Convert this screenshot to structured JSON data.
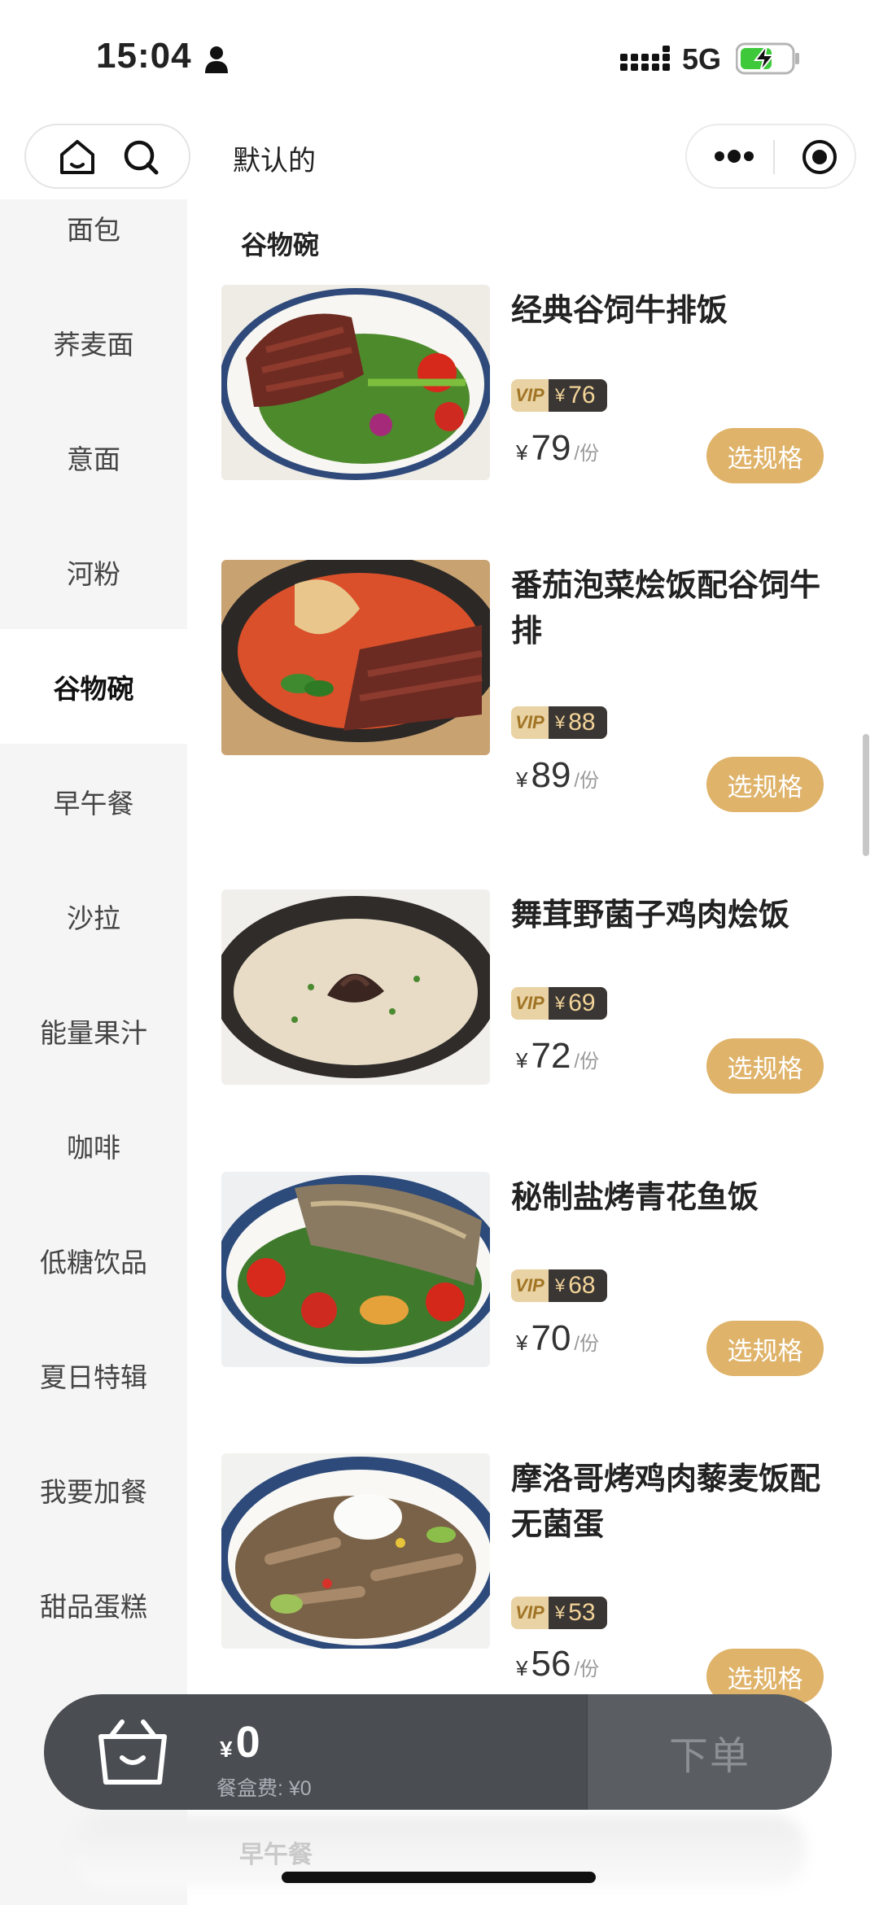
{
  "status_bar": {
    "time": "15:04",
    "network": "5G"
  },
  "nav": {
    "title": "默认的"
  },
  "sidebar": {
    "items": [
      {
        "label": "面包"
      },
      {
        "label": "荞麦面"
      },
      {
        "label": "意面"
      },
      {
        "label": "河粉"
      },
      {
        "label": "谷物碗",
        "active": true
      },
      {
        "label": "早午餐"
      },
      {
        "label": "沙拉"
      },
      {
        "label": "能量果汁"
      },
      {
        "label": "咖啡"
      },
      {
        "label": "低糖饮品"
      },
      {
        "label": "夏日特辑"
      },
      {
        "label": "我要加餐"
      },
      {
        "label": "甜品蛋糕"
      }
    ]
  },
  "section": {
    "title": "谷物碗"
  },
  "items": [
    {
      "name": "经典谷饲牛排饭",
      "vip_label": "VIP",
      "vip_price": "76",
      "price": "79",
      "unit": "/份",
      "button": "选规格"
    },
    {
      "name": "番茄泡菜烩饭配谷饲牛排",
      "vip_label": "VIP",
      "vip_price": "88",
      "price": "89",
      "unit": "/份",
      "button": "选规格"
    },
    {
      "name": "舞茸野菌子鸡肉烩饭",
      "vip_label": "VIP",
      "vip_price": "69",
      "price": "72",
      "unit": "/份",
      "button": "选规格"
    },
    {
      "name": "秘制盐烤青花鱼饭",
      "vip_label": "VIP",
      "vip_price": "68",
      "price": "70",
      "unit": "/份",
      "button": "选规格"
    },
    {
      "name": "摩洛哥烤鸡肉藜麦饭配无菌蛋",
      "vip_label": "VIP",
      "vip_price": "53",
      "price": "56",
      "unit": "/份",
      "button": "选规格"
    }
  ],
  "currency_symbol": "¥",
  "cart": {
    "total": "0",
    "box_fee": "餐盒费: ¥0",
    "order_label": "下单"
  },
  "below_cart_label": "早午餐"
}
